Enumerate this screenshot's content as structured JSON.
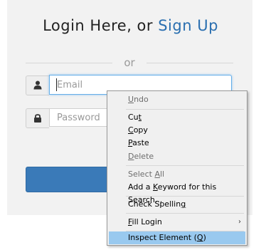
{
  "login": {
    "title_prefix": "Login Here, or ",
    "signup_link": "Sign Up",
    "divider_text": "or",
    "email_placeholder": "Email",
    "password_placeholder": "Password"
  },
  "icons": {
    "email_addon": "user-icon",
    "password_addon": "lock-icon"
  },
  "context_menu": {
    "items": [
      {
        "label": "Undo",
        "underline": "U",
        "disabled": true
      },
      {
        "label": "Cut",
        "underline": "t",
        "disabled": false
      },
      {
        "label": "Copy",
        "underline": "C",
        "disabled": false
      },
      {
        "label": "Paste",
        "underline": "P",
        "disabled": false
      },
      {
        "label": "Delete",
        "underline": "D",
        "disabled": true
      },
      {
        "label": "Select All",
        "underline": "A",
        "disabled": true
      },
      {
        "label": "Add a Keyword for this Search...",
        "underline": "K",
        "disabled": false
      },
      {
        "label": "Check Spelling",
        "underline": "g",
        "disabled": false
      },
      {
        "label": "Fill Login",
        "underline": "F",
        "disabled": false,
        "submenu": true
      },
      {
        "label": "Inspect Element (Q)",
        "underline": "Q",
        "disabled": false,
        "highlighted": true
      }
    ]
  },
  "colors": {
    "accent": "#2a6fb0",
    "button": "#3a7ab8",
    "menu_highlight": "#99c9ef"
  }
}
